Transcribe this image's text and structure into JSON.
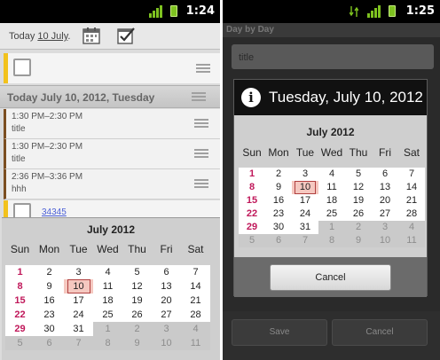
{
  "left_screen": {
    "status_time": "1:24",
    "today_label": "Today",
    "today_date": "10 July",
    "day_header": "Today July 10, 2012, Tuesday",
    "events": [
      {
        "time": "1:30 PM–2:30 PM",
        "title": "title"
      },
      {
        "time": "1:30 PM–2:30 PM",
        "title": "title"
      },
      {
        "time": "2:36 PM–3:36 PM",
        "title": "hhh"
      }
    ],
    "partial_event_text": "34345",
    "calendar": {
      "month_title": "July 2012",
      "weekdays": [
        "Sun",
        "Mon",
        "Tue",
        "Wed",
        "Thu",
        "Fri",
        "Sat"
      ],
      "weeks": [
        [
          "1",
          "2",
          "3",
          "4",
          "5",
          "6",
          "7"
        ],
        [
          "8",
          "9",
          "10",
          "11",
          "12",
          "13",
          "14"
        ],
        [
          "15",
          "16",
          "17",
          "18",
          "19",
          "20",
          "21"
        ],
        [
          "22",
          "23",
          "24",
          "25",
          "26",
          "27",
          "28"
        ],
        [
          "29",
          "30",
          "31",
          "1",
          "2",
          "3",
          "4"
        ],
        [
          "5",
          "6",
          "7",
          "8",
          "9",
          "10",
          "11"
        ]
      ]
    }
  },
  "right_screen": {
    "status_time": "1:25",
    "app_title": "Day by Day",
    "title_field_value": "title",
    "dialog": {
      "title": "Tuesday, July 10, 2012",
      "month_title": "July 2012",
      "weekdays": [
        "Sun",
        "Mon",
        "Tue",
        "Wed",
        "Thu",
        "Fri",
        "Sat"
      ],
      "weeks": [
        [
          "1",
          "2",
          "3",
          "4",
          "5",
          "6",
          "7"
        ],
        [
          "8",
          "9",
          "10",
          "11",
          "12",
          "13",
          "14"
        ],
        [
          "15",
          "16",
          "17",
          "18",
          "19",
          "20",
          "21"
        ],
        [
          "22",
          "23",
          "24",
          "25",
          "26",
          "27",
          "28"
        ],
        [
          "29",
          "30",
          "31",
          "1",
          "2",
          "3",
          "4"
        ],
        [
          "5",
          "6",
          "7",
          "8",
          "9",
          "10",
          "11"
        ]
      ],
      "cancel_label": "Cancel"
    },
    "save_label": "Save",
    "cancel_label": "Cancel"
  },
  "colors": {
    "sunday_red": "#c0185a",
    "all_day_accent": "#f2c21c",
    "event_accent": "#7b4e21",
    "selected_day_bg": "#f5c8c0"
  },
  "icons": [
    "signal-icon",
    "battery-icon",
    "calendar-icon",
    "task-icon",
    "info-icon",
    "drag-handle-icon",
    "checkbox-icon"
  ]
}
